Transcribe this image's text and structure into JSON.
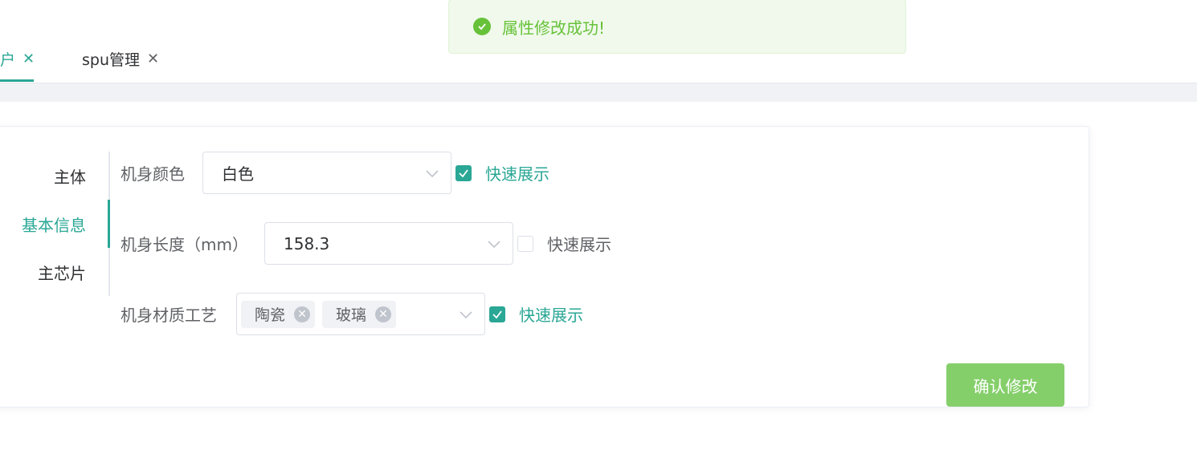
{
  "toast": {
    "message": "属性修改成功!",
    "icon": "check-circle-icon",
    "color": "#67c23a"
  },
  "tabs": [
    {
      "label": "户",
      "active": true
    },
    {
      "label": "spu管理",
      "active": false
    }
  ],
  "side_tabs": [
    {
      "label": "主体",
      "active": false
    },
    {
      "label": "基本信息",
      "active": true
    },
    {
      "label": "主芯片",
      "active": false
    }
  ],
  "form": {
    "rows": [
      {
        "label": "机身颜色",
        "value": "白色",
        "quick_show_label": "快速展示",
        "quick_show_checked": true
      },
      {
        "label": "机身长度（mm）",
        "value": "158.3",
        "quick_show_label": "快速展示",
        "quick_show_checked": false
      },
      {
        "label": "机身材质工艺",
        "tags": [
          "陶瓷",
          "玻璃"
        ],
        "quick_show_label": "快速展示",
        "quick_show_checked": true
      }
    ]
  },
  "confirm_button": {
    "label": "确认修改"
  },
  "colors": {
    "accent": "#2aa795",
    "button": "#85cf6b",
    "success": "#67c23a"
  }
}
